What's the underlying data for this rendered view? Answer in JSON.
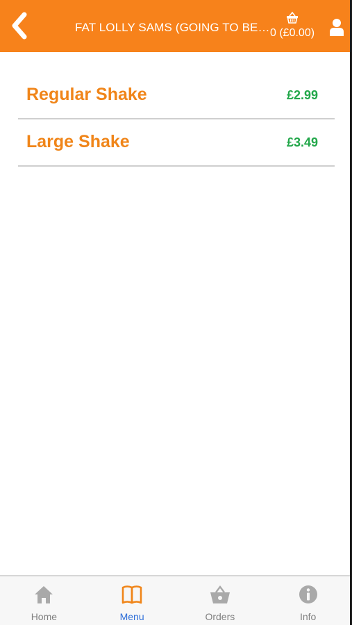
{
  "header": {
    "title": "FAT LOLLY SAMS (GOING TO BE FAT LOLLY SAMS)",
    "basket_text": "0 (£0.00)",
    "back_icon": "chevron-left-icon",
    "basket_icon": "basket-icon",
    "user_icon": "user-icon"
  },
  "menu": {
    "items": [
      {
        "name": "Regular Shake",
        "price": "£2.99"
      },
      {
        "name": "Large Shake",
        "price": "£3.49"
      }
    ]
  },
  "nav": {
    "items": [
      {
        "label": "Home",
        "icon": "home-icon",
        "active": false
      },
      {
        "label": "Menu",
        "icon": "book-icon",
        "active": true
      },
      {
        "label": "Orders",
        "icon": "basket-icon",
        "active": false
      },
      {
        "label": "Info",
        "icon": "info-icon",
        "active": false
      }
    ]
  },
  "colors": {
    "header_bg": "#f7821b",
    "item_name": "#f08519",
    "price": "#22a74a",
    "nav_active": "#2f6fd8",
    "nav_inactive": "#808080"
  }
}
